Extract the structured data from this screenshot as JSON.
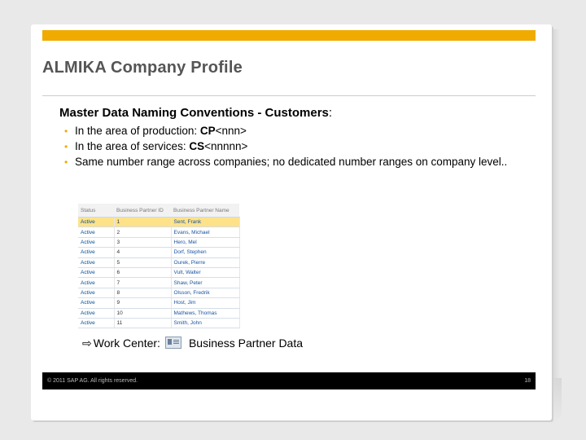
{
  "slide": {
    "title": "ALMIKA Company Profile",
    "heading_bold": "Master Data Naming Conventions - Customers",
    "heading_rest": ":",
    "bullets": [
      {
        "text": "In the area of production: ",
        "bold": "CP",
        "suffix": "<nnn>"
      },
      {
        "text": "In the area of services: ",
        "bold": "CS",
        "suffix": "<nnnnn>"
      },
      {
        "text": "Same number range across companies; no dedicated number ranges on company level..",
        "bold": "",
        "suffix": ""
      }
    ],
    "bullet_color": "#f0ab00"
  },
  "table": {
    "headers": [
      "Status",
      "Business Partner ID",
      "Business Partner Name"
    ],
    "rows": [
      [
        "Active",
        "1",
        "Sent, Frank"
      ],
      [
        "Active",
        "2",
        "Evans, Michael"
      ],
      [
        "Active",
        "3",
        "Hero, Mel"
      ],
      [
        "Active",
        "4",
        "Dorf, Stephen"
      ],
      [
        "Active",
        "5",
        "Ourek, Pierre"
      ],
      [
        "Active",
        "6",
        "Vult, Walter"
      ],
      [
        "Active",
        "7",
        "Shaw, Peter"
      ],
      [
        "Active",
        "8",
        "Olsson, Fredrik"
      ],
      [
        "Active",
        "9",
        "Host, Jim"
      ],
      [
        "Active",
        "10",
        "Mathews, Thomas"
      ],
      [
        "Active",
        "11",
        "Smith, John"
      ]
    ],
    "selected_row": 0,
    "selected_color": "#fde28a"
  },
  "workcenter": {
    "arrow": "⇨",
    "label": "Work Center:",
    "icon": "business-partner-icon",
    "name": "Business Partner Data"
  },
  "footer": {
    "copyright": "© 2011 SAP AG. All rights reserved.",
    "page": "18"
  },
  "colors": {
    "accent_bar": "#f0ab00",
    "footer_bg": "#000000"
  }
}
